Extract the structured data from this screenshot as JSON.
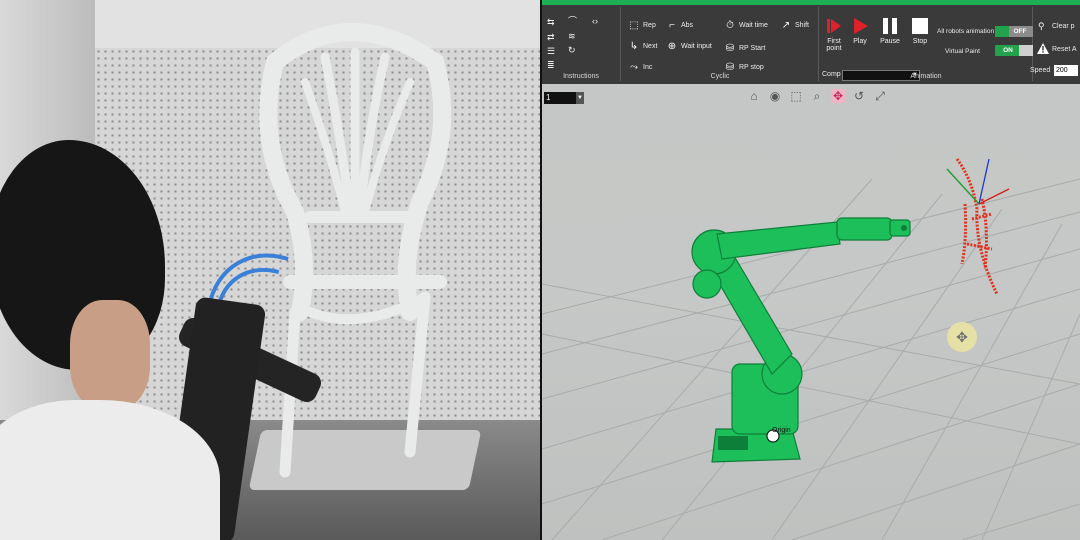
{
  "ribbon": {
    "instructions": {
      "label": "Instructions"
    },
    "cyclic": {
      "label": "Cyclic",
      "commands": {
        "rep": "Rep",
        "abs": "Abs",
        "wait_time": "Wait time",
        "shift": "Shift",
        "next": "Next",
        "wait_input": "Wait input",
        "rp_start": "RP Start",
        "inc": "Inc",
        "rp_stop": "RP stop"
      }
    },
    "animation": {
      "label": "Animation",
      "first_point": "First point",
      "play": "Play",
      "pause": "Pause",
      "stop": "Stop",
      "comp_label": "Comp",
      "comp_value": "",
      "all_robots_animation": "All robots animation",
      "all_robots_state": "OFF",
      "virtual_paint": "Virtual Paint",
      "virtual_paint_state": "ON",
      "speed_label": "Speed",
      "speed_value": "200"
    },
    "extra": {
      "clear": "Clear p",
      "reset": "Reset A"
    }
  },
  "viewport": {
    "layer_value": "1",
    "robot_label": "Origin"
  },
  "colors": {
    "brand_green": "#1fae54",
    "robot_green": "#1dbf5a",
    "path_red": "#e2321e",
    "play_red": "#e0212b",
    "on_green": "#22a24a"
  }
}
